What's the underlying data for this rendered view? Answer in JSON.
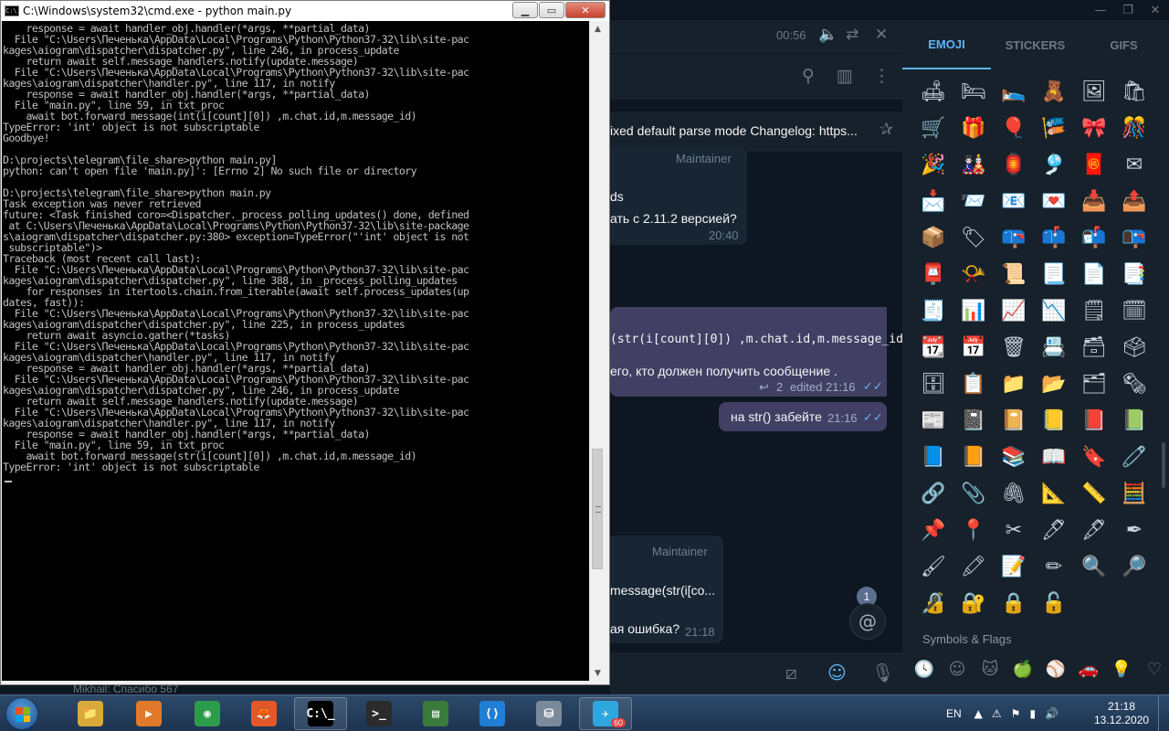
{
  "telegram": {
    "window_controls": [
      "—",
      "❐",
      "✕"
    ],
    "player": {
      "time": "00:56",
      "volume_icon": "speaker-icon",
      "repeat_icon": "repeat-icon",
      "close_icon": "close-icon"
    },
    "header_icons": [
      "search-icon",
      "sidebar-toggle-icon",
      "more-icon"
    ],
    "pinned_text": "ixed default parse mode  Changelog: https...",
    "messages": [
      {
        "author": "Maintainer",
        "line1": "ds",
        "line2": "ать с 2.11.2 версией?",
        "time": "20:40"
      },
      {
        "code": "(str(i[count][0]) ,m.chat.id,m.message_id)",
        "line2": "его, кто должен получить сообщение .",
        "replies": "2",
        "edited": "edited 21:16"
      },
      {
        "text": "на str() забейте",
        "time": "21:16"
      },
      {
        "author": "Maintainer",
        "line1": "message(str(i[co...",
        "line2": "ая ошибка?",
        "time": "21:18"
      }
    ],
    "unread_count": "1",
    "mention_symbol": "@",
    "emoji_panel": {
      "tabs": [
        "EMOJI",
        "STICKERS",
        "GIFS"
      ],
      "active_tab": "EMOJI",
      "emojis": [
        "🛋",
        "🛏",
        "🛌",
        "🧸",
        "🖼",
        "🛍",
        "🛒",
        "🎁",
        "🎈",
        "🎏",
        "🎀",
        "🎊",
        "🎉",
        "🎎",
        "🏮",
        "🎐",
        "🧧",
        "✉",
        "📩",
        "📨",
        "📧",
        "💌",
        "📥",
        "📤",
        "📦",
        "🏷",
        "📪",
        "📫",
        "📬",
        "📭",
        "📮",
        "📯",
        "📜",
        "📃",
        "📄",
        "📑",
        "🧾",
        "📊",
        "📈",
        "📉",
        "🗒",
        "🗓",
        "📆",
        "📅",
        "🗑",
        "📇",
        "🗃",
        "🗳",
        "🗄",
        "📋",
        "📁",
        "📂",
        "🗂",
        "🗞",
        "📰",
        "📓",
        "📔",
        "📒",
        "📕",
        "📗",
        "📘",
        "📙",
        "📚",
        "📖",
        "🔖",
        "🧷",
        "🔗",
        "📎",
        "🖇",
        "📐",
        "📏",
        "🧮",
        "📌",
        "📍",
        "✂",
        "🖊",
        "🖋",
        "✒",
        "🖌",
        "🖍",
        "📝",
        "✏",
        "🔍",
        "🔎",
        "🔏",
        "🔐",
        "🔒",
        "🔓"
      ],
      "section_label": "Symbols & Flags",
      "categories": [
        "🕓",
        "☺",
        "🐱",
        "🍏",
        "⚾",
        "🚗",
        "💡",
        "♡"
      ]
    },
    "input_icons": [
      "bot-command-icon",
      "emoji-icon",
      "microphone-icon"
    ],
    "chat_list_peek": "Mikhail: Спасибо   567"
  },
  "cmd": {
    "title": "C:\\Windows\\system32\\cmd.exe - python  main.py",
    "controls": [
      "▁",
      "▭",
      "✕"
    ],
    "output": "    response = await handler_obj.handler(*args, **partial_data)\n  File \"C:\\Users\\Печенька\\AppData\\Local\\Programs\\Python\\Python37-32\\lib\\site-pac\nkages\\aiogram\\dispatcher\\dispatcher.py\", line 246, in process_update\n    return await self.message_handlers.notify(update.message)\n  File \"C:\\Users\\Печенька\\AppData\\Local\\Programs\\Python\\Python37-32\\lib\\site-pac\nkages\\aiogram\\dispatcher\\handler.py\", line 117, in notify\n    response = await handler_obj.handler(*args, **partial_data)\n  File \"main.py\", line 59, in txt_proc\n    await bot.forward_message(int(i[count][0]) ,m.chat.id,m.message_id)\nTypeError: 'int' object is not subscriptable\nGoodbye!\n\nD:\\projects\\telegram\\file_share>python main.py]\npython: can't open file 'main.py]': [Errno 2] No such file or directory\n\nD:\\projects\\telegram\\file_share>python main.py\nTask exception was never retrieved\nfuture: <Task finished coro=<Dispatcher._process_polling_updates() done, defined\n at C:\\Users\\Печенька\\AppData\\Local\\Programs\\Python\\Python37-32\\lib\\site-package\ns\\aiogram\\dispatcher\\dispatcher.py:380> exception=TypeError(\"'int' object is not\n subscriptable\")>\nTraceback (most recent call last):\n  File \"C:\\Users\\Печенька\\AppData\\Local\\Programs\\Python\\Python37-32\\lib\\site-pac\nkages\\aiogram\\dispatcher\\dispatcher.py\", line 388, in _process_polling_updates\n    for responses in itertools.chain.from_iterable(await self.process_updates(up\ndates, fast)):\n  File \"C:\\Users\\Печенька\\AppData\\Local\\Programs\\Python\\Python37-32\\lib\\site-pac\nkages\\aiogram\\dispatcher\\dispatcher.py\", line 225, in process_updates\n    return await asyncio.gather(*tasks)\n  File \"C:\\Users\\Печенька\\AppData\\Local\\Programs\\Python\\Python37-32\\lib\\site-pac\nkages\\aiogram\\dispatcher\\handler.py\", line 117, in notify\n    response = await handler_obj.handler(*args, **partial_data)\n  File \"C:\\Users\\Печенька\\AppData\\Local\\Programs\\Python\\Python37-32\\lib\\site-pac\nkages\\aiogram\\dispatcher\\dispatcher.py\", line 246, in process_update\n    return await self.message_handlers.notify(update.message)\n  File \"C:\\Users\\Печенька\\AppData\\Local\\Programs\\Python\\Python37-32\\lib\\site-pac\nkages\\aiogram\\dispatcher\\handler.py\", line 117, in notify\n    response = await handler_obj.handler(*args, **partial_data)\n  File \"main.py\", line 59, in txt_proc\n    await bot.forward_message(str(i[count][0]) ,m.chat.id,m.message_id)\nTypeError: 'int' object is not subscriptable"
  },
  "taskbar": {
    "apps": [
      {
        "name": "explorer",
        "glyph": "📁",
        "color": "#d9a93c"
      },
      {
        "name": "media-player",
        "glyph": "▶",
        "color": "#e07a2a"
      },
      {
        "name": "chrome",
        "glyph": "◉",
        "color": "#2e9b4a"
      },
      {
        "name": "firefox",
        "glyph": "🦊",
        "color": "#e2582a"
      },
      {
        "name": "cmd",
        "glyph": "C:\\_",
        "color": "#000000"
      },
      {
        "name": "powershell",
        "glyph": ">_",
        "color": "#2b2b2b"
      },
      {
        "name": "task-manager",
        "glyph": "▤",
        "color": "#3a7a3a"
      },
      {
        "name": "vscode",
        "glyph": "⟨⟩",
        "color": "#1f7fd4"
      },
      {
        "name": "db-tool",
        "glyph": "⛁",
        "color": "#7a8a9a"
      },
      {
        "name": "telegram",
        "glyph": "✈",
        "color": "#2ea6de"
      }
    ],
    "telegram_badge": "60",
    "language": "EN",
    "tray_icons": [
      "▲",
      "⚠",
      "⚑",
      "▮",
      "🔊"
    ],
    "time": "21:18",
    "date": "13.12.2020"
  }
}
